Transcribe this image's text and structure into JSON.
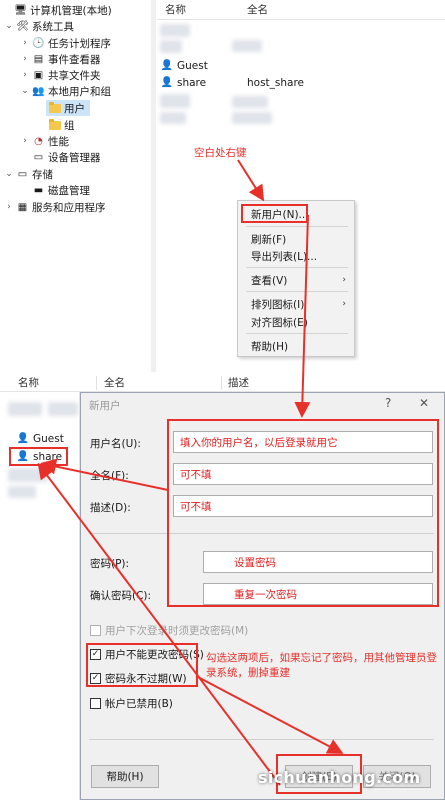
{
  "console": {
    "tree": [
      {
        "label": "计算机管理(本地)",
        "icon": "computer-mgmt-icon",
        "glyph": "🖥",
        "expand": ""
      },
      {
        "label": "系统工具",
        "icon": "tools-icon",
        "glyph": "🛠",
        "expand": "⌄"
      },
      {
        "label": "任务计划程序",
        "icon": "clock-icon",
        "glyph": "🕒",
        "expand": "›"
      },
      {
        "label": "事件查看器",
        "icon": "event-viewer-icon",
        "glyph": "▤",
        "expand": "›"
      },
      {
        "label": "共享文件夹",
        "icon": "shared-folder-icon",
        "glyph": "▣",
        "expand": "›"
      },
      {
        "label": "本地用户和组",
        "icon": "users-groups-icon",
        "glyph": "👥",
        "expand": "⌄"
      },
      {
        "label": "用户",
        "icon": "folder-icon",
        "glyph": "",
        "expand": ""
      },
      {
        "label": "组",
        "icon": "folder-icon",
        "glyph": "",
        "expand": ""
      },
      {
        "label": "性能",
        "icon": "performance-icon",
        "glyph": "◔",
        "expand": "›"
      },
      {
        "label": "设备管理器",
        "icon": "device-manager-icon",
        "glyph": "▭",
        "expand": ""
      },
      {
        "label": "存储",
        "icon": "storage-icon",
        "glyph": "▭",
        "expand": "⌄"
      },
      {
        "label": "磁盘管理",
        "icon": "disk-icon",
        "glyph": "▬",
        "expand": ""
      },
      {
        "label": "服务和应用程序",
        "icon": "services-icon",
        "glyph": "▦",
        "expand": "›"
      }
    ],
    "list_columns": {
      "name": "名称",
      "fullname": "全名"
    },
    "rows": [
      {
        "name": "Guest",
        "fullname": ""
      },
      {
        "name": "share",
        "fullname": "host_share"
      }
    ],
    "annotation_right_click": "空白处右键"
  },
  "context_menu": {
    "items": [
      {
        "label": "新用户(N)...",
        "submenu": false
      },
      {
        "label": "刷新(F)",
        "submenu": false
      },
      {
        "label": "导出列表(L)...",
        "submenu": false
      },
      {
        "label": "查看(V)",
        "submenu": true
      },
      {
        "label": "排列图标(I)",
        "submenu": true
      },
      {
        "label": "对齐图标(E)",
        "submenu": false
      },
      {
        "label": "帮助(H)",
        "submenu": false
      }
    ],
    "arrow_glyph": "›"
  },
  "bottom_list": {
    "columns": {
      "name": "名称",
      "fullname": "全名",
      "description": "描述"
    },
    "rows": [
      {
        "name": "Guest"
      },
      {
        "name": "share"
      }
    ]
  },
  "dialog": {
    "title": "新用户",
    "help_glyph": "?",
    "close_glyph": "✕",
    "fields": {
      "username": {
        "label": "用户名(U):",
        "value": "填入你的用户名，以后登录就用它"
      },
      "fullname": {
        "label": "全名(F):",
        "value": "可不填"
      },
      "description": {
        "label": "描述(D):",
        "value": "可不填"
      },
      "password": {
        "label": "密码(P):",
        "value": "设置密码"
      },
      "confirm": {
        "label": "确认密码(C):",
        "value": "重复一次密码"
      }
    },
    "checkboxes": [
      {
        "label": "用户下次登录时须更改密码(M)",
        "checked": false,
        "disabled": true
      },
      {
        "label": "用户不能更改密码(S)",
        "checked": true,
        "disabled": false
      },
      {
        "label": "密码永不过期(W)",
        "checked": true,
        "disabled": false
      },
      {
        "label": "帐户已禁用(B)",
        "checked": false,
        "disabled": false
      }
    ],
    "check_glyph": "✓",
    "annotation_checkboxes": "勾选这两项后，如果忘记了密码，用其他管理员登录系统，删掉重建",
    "buttons": {
      "help": "帮助(H)",
      "create": "创建(E)",
      "close": "关闭(O)"
    }
  },
  "watermark": "sichuanhong.com",
  "colors": {
    "annotation_red": "#e8302a",
    "selection": "#cce4f7",
    "dialog_bg": "#f0f0f0"
  }
}
